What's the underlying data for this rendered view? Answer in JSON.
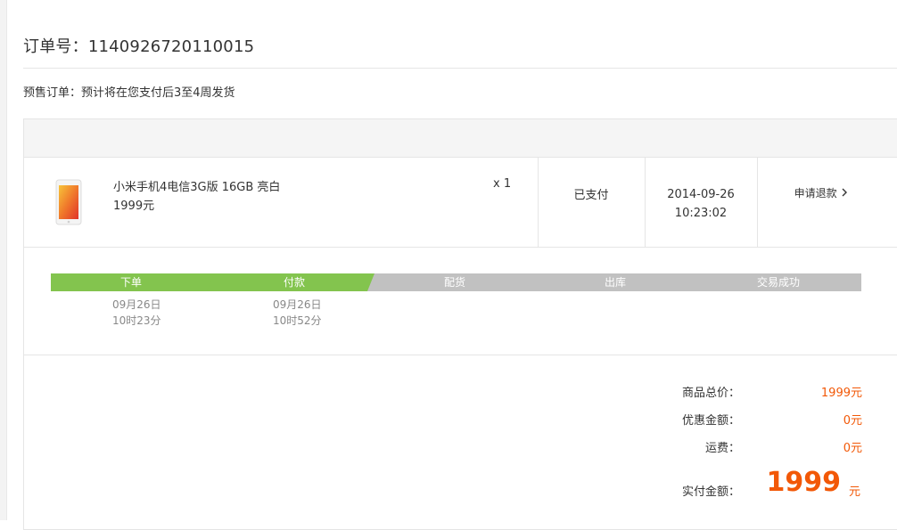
{
  "order": {
    "label": "订单号：",
    "number": "1140926720110015",
    "presale_note": "预售订单：预计将在您支付后3至4周发货"
  },
  "item": {
    "name": "小米手机4电信3G版 16GB 亮白",
    "price": "1999元",
    "quantity": "x 1",
    "status": "已支付",
    "date": "2014-09-26",
    "time": "10:23:02",
    "refund_label": "申请退款"
  },
  "progress": {
    "steps": [
      {
        "label": "下单",
        "date": "09月26日",
        "time": "10时23分",
        "done": true
      },
      {
        "label": "付款",
        "date": "09月26日",
        "time": "10时52分",
        "done": true
      },
      {
        "label": "配货",
        "done": false
      },
      {
        "label": "出库",
        "done": false
      },
      {
        "label": "交易成功",
        "done": false
      }
    ],
    "colors": {
      "done": "#83c44e",
      "pending": "#c1c1c1",
      "separator": "#ffffff"
    }
  },
  "summary": {
    "subtotal_label": "商品总价：",
    "subtotal_value": "1999元",
    "discount_label": "优惠金额：",
    "discount_value": "0元",
    "shipping_label": "运费：",
    "shipping_value": "0元",
    "paid_label": "实付金额：",
    "paid_value": "1999",
    "paid_unit": "元"
  },
  "icons": {
    "refund_arrow": "chevron-right-icon",
    "product_image": "phone-thumbnail"
  },
  "accent_color": "#f25807"
}
